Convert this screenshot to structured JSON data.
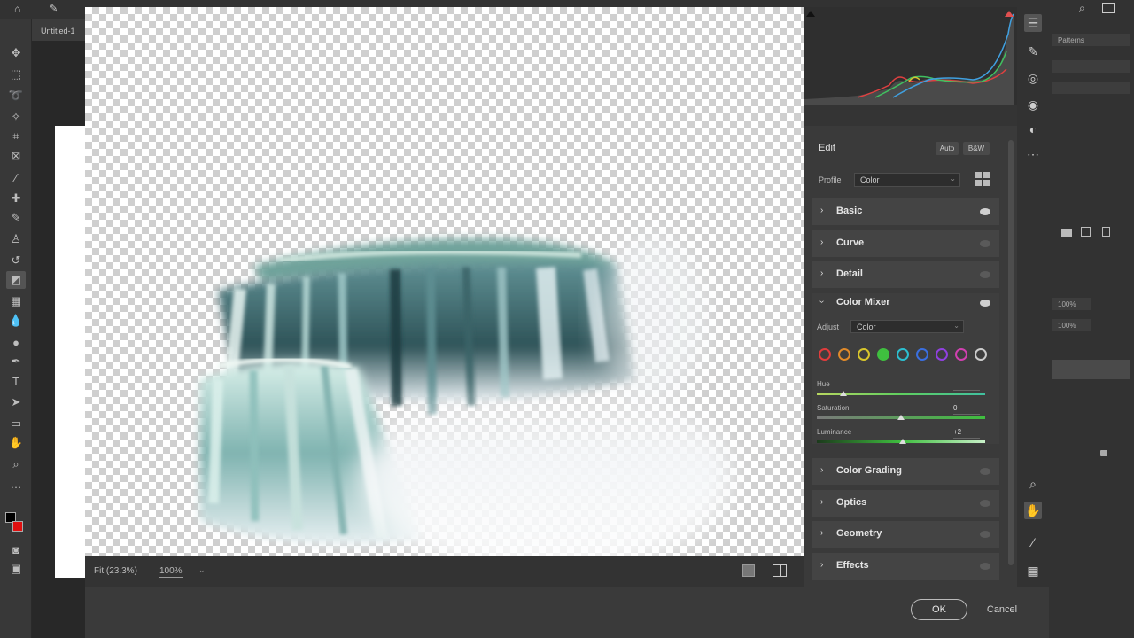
{
  "photoshop": {
    "doc_tab": "Untitled-1",
    "right_panel": {
      "tab_label": "Patterns",
      "opacity_value": "100%",
      "fill_value": "100%"
    }
  },
  "acr": {
    "status": {
      "fit_label": "Fit (23.3%)",
      "zoom_value": "100%"
    },
    "edit": {
      "title": "Edit",
      "auto_label": "Auto",
      "bw_label": "B&W",
      "profile_label": "Profile",
      "profile_value": "Color"
    },
    "sections": [
      {
        "label": "Basic",
        "visible": true
      },
      {
        "label": "Curve",
        "visible": false
      },
      {
        "label": "Detail",
        "visible": false
      },
      {
        "label": "Color Mixer",
        "visible": true
      },
      {
        "label": "Color Grading",
        "visible": false
      },
      {
        "label": "Optics",
        "visible": false
      },
      {
        "label": "Geometry",
        "visible": false
      },
      {
        "label": "Effects",
        "visible": false
      }
    ],
    "color_mixer": {
      "adjust_label": "Adjust",
      "adjust_value": "Color",
      "swatches": [
        {
          "name": "red",
          "color": "#e03c3c"
        },
        {
          "name": "orange",
          "color": "#e08a2a"
        },
        {
          "name": "yellow",
          "color": "#d8c62c"
        },
        {
          "name": "green",
          "color": "#3fbf3f",
          "selected": true
        },
        {
          "name": "aqua",
          "color": "#2cbfd0"
        },
        {
          "name": "blue",
          "color": "#3a6fe0"
        },
        {
          "name": "purple",
          "color": "#9040e0"
        },
        {
          "name": "magenta",
          "color": "#d040b0"
        },
        {
          "name": "all",
          "color": "#cccccc"
        }
      ],
      "sliders": [
        {
          "label": "Hue",
          "value": "",
          "level": 0.16
        },
        {
          "label": "Saturation",
          "value": "0",
          "level": 0.5
        },
        {
          "label": "Luminance",
          "value": "+2",
          "level": 0.51
        }
      ]
    },
    "buttons": {
      "ok_label": "OK",
      "cancel_label": "Cancel"
    }
  }
}
